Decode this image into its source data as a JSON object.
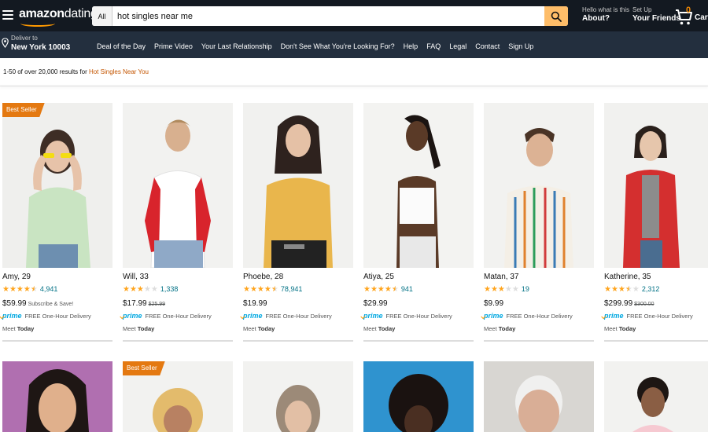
{
  "header": {
    "logo_brand": "amazon",
    "logo_suffix": "dating",
    "search_category": "All",
    "search_value": "hot singles near me",
    "account_small": "Hello what is this",
    "account_big": "About?",
    "setup_small": "Set Up",
    "setup_big": "Your Friends",
    "cart_count": "0",
    "cart_label": "Cart",
    "deliver_small": "Deliver to",
    "deliver_big": "New York 10003"
  },
  "nav": {
    "links": [
      "Deal of the Day",
      "Prime Video",
      "Your Last Relationship",
      "Don't See What You're Looking For?",
      "Help",
      "FAQ",
      "Legal",
      "Contact",
      "Sign Up"
    ]
  },
  "results": {
    "prefix": "1-50 of over 20,000 results for ",
    "query": "Hot Singles Near You"
  },
  "icons": {
    "menu": "hamburger-icon",
    "search": "search-icon",
    "cart": "cart-icon",
    "location": "location-pin-icon"
  },
  "colors": {
    "topbar": "#131921",
    "navbar": "#232f3e",
    "accent": "#ff9900",
    "badge": "#e47911",
    "link": "#007185",
    "prime": "#00a8e1"
  },
  "cards_row1": [
    {
      "badge": "Best Seller",
      "name": "Amy, 29",
      "rating": 4.5,
      "reviews": "4,941",
      "price": "$59.99",
      "extra": "Subscribe & Save!",
      "old": "",
      "prime": "prime",
      "delivery": "FREE One-Hour Delivery",
      "meet": "Meet ",
      "meet_when": "Today"
    },
    {
      "badge": "",
      "name": "Will, 33",
      "rating": 3,
      "reviews": "1,338",
      "price": "$17.99",
      "extra": "",
      "old": "$25.99",
      "prime": "prime",
      "delivery": "FREE One-Hour Delivery",
      "meet": "Meet ",
      "meet_when": "Today"
    },
    {
      "badge": "",
      "name": "Phoebe, 28",
      "rating": 4.5,
      "reviews": "78,941",
      "price": "$19.99",
      "extra": "",
      "old": "",
      "prime": "prime",
      "delivery": "FREE One-Hour Delivery",
      "meet": "Meet ",
      "meet_when": "Today"
    },
    {
      "badge": "",
      "name": "Atiya, 25",
      "rating": 4.5,
      "reviews": "941",
      "price": "$29.99",
      "extra": "",
      "old": "",
      "prime": "prime",
      "delivery": "FREE One-Hour Delivery",
      "meet": "Meet ",
      "meet_when": "Today"
    },
    {
      "badge": "",
      "name": "Matan, 37",
      "rating": 3,
      "reviews": "19",
      "price": "$9.99",
      "extra": "",
      "old": "",
      "prime": "prime",
      "delivery": "FREE One-Hour Delivery",
      "meet": "Meet ",
      "meet_when": "Today"
    },
    {
      "badge": "",
      "name": "Katherine, 35",
      "rating": 3.5,
      "reviews": "2,312",
      "price": "$299.99",
      "extra": "",
      "old": "$300.00",
      "prime": "prime",
      "delivery": "FREE One-Hour Delivery",
      "meet": "Meet ",
      "meet_when": "Today"
    }
  ],
  "cards_row2": [
    {
      "badge": ""
    },
    {
      "badge": "Best Seller"
    },
    {
      "badge": ""
    },
    {
      "badge": ""
    },
    {
      "badge": ""
    },
    {
      "badge": ""
    }
  ]
}
